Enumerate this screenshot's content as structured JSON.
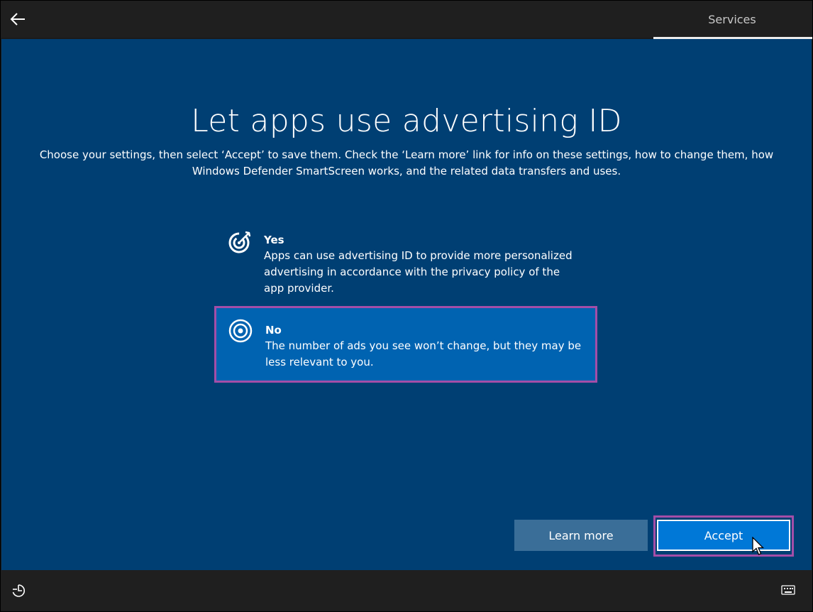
{
  "header": {
    "tab_label": "Services"
  },
  "main": {
    "title": "Let apps use advertising ID",
    "subtitle_line1": "Choose your settings, then select ‘Accept’ to save them. Check the ‘Learn more’ link for info on these settings, how to change them, how",
    "subtitle_line2": "Windows Defender SmartScreen works, and the related data transfers and uses."
  },
  "options": [
    {
      "title": "Yes",
      "description": "Apps can use advertising ID to provide more personalized advertising in accordance with the privacy policy of the app provider.",
      "icon": "target-arrow-icon",
      "selected": false
    },
    {
      "title": "No",
      "description": "The number of ads you see won’t change, but they may be less relevant to you.",
      "icon": "target-icon",
      "selected": true
    }
  ],
  "buttons": {
    "learn_more": "Learn more",
    "accept": "Accept"
  },
  "colors": {
    "background": "#003f73",
    "selected_option": "#0063b1",
    "accept_button": "#0078d7",
    "learn_more_button": "#3a6e98",
    "highlight_outline": "#a44ea8"
  }
}
